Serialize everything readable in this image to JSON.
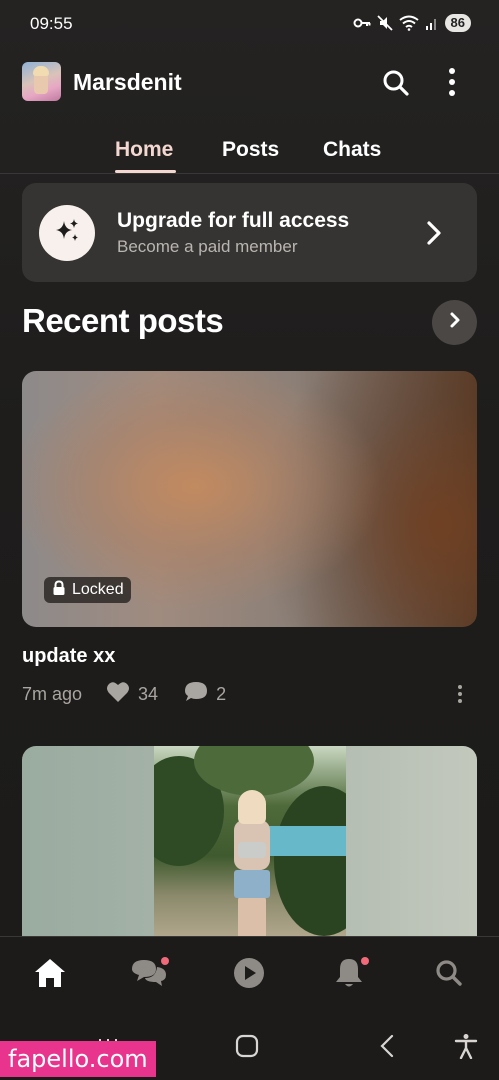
{
  "status_bar": {
    "time": "09:55",
    "battery": "86",
    "icons": [
      "key-icon",
      "mute-icon",
      "wifi-icon",
      "signal-icon",
      "battery-icon"
    ]
  },
  "header": {
    "creator_name": "Marsdenit",
    "icons": [
      "search-icon",
      "more-vertical-icon"
    ]
  },
  "tabs": [
    {
      "label": "Home",
      "active": true
    },
    {
      "label": "Posts",
      "active": false
    },
    {
      "label": "Chats",
      "active": false
    }
  ],
  "upgrade_card": {
    "title": "Upgrade for full access",
    "subtitle": "Become a paid member",
    "icon": "sparkles-icon"
  },
  "recent_posts": {
    "title": "Recent posts",
    "posts": [
      {
        "title": "update xx",
        "time": "7m ago",
        "likes": "34",
        "comments": "2",
        "badge": "Locked"
      }
    ]
  },
  "bottom_nav": {
    "items": [
      "home-icon",
      "chats-icon",
      "play-icon",
      "bell-icon",
      "search-icon"
    ],
    "notification_dots": [
      "chats",
      "notifications"
    ]
  },
  "colors": {
    "background": "#1e1d1c",
    "card": "#363432",
    "accent": "#f3d7d0",
    "muted_text": "#a9a5a1",
    "notification_dot": "#f06a7a",
    "watermark": "#e8348c"
  },
  "watermark": "fapello.com"
}
